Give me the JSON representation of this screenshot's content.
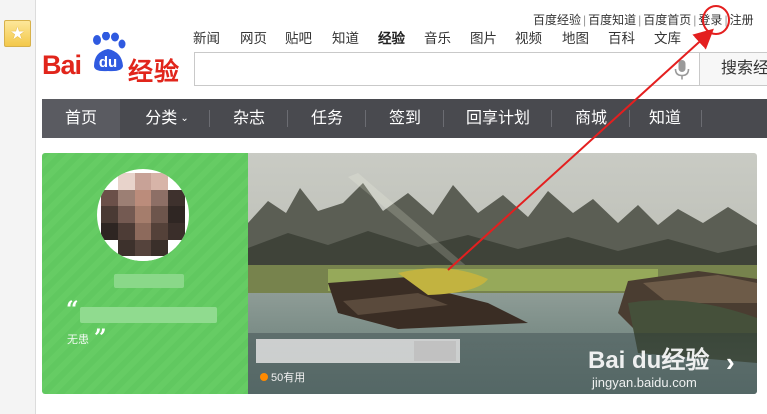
{
  "favorites": {
    "icon": "star-icon",
    "glyph": "★"
  },
  "logo": {
    "bai": "Bai",
    "du": "du",
    "jingyan": "经验",
    "brand_color": "#e1251b",
    "paw_color": "#2f5ae0"
  },
  "top_links": [
    "百度经验",
    "百度知道",
    "百度首页",
    "登录",
    "注册"
  ],
  "product_nav": [
    "新闻",
    "网页",
    "贴吧",
    "知道",
    "经验",
    "音乐",
    "图片",
    "视频",
    "地图",
    "百科",
    "文库"
  ],
  "product_nav_active": "经验",
  "search": {
    "value": "",
    "button_label": "搜索经"
  },
  "main_nav": {
    "items": [
      "首页",
      "分类",
      "杂志",
      "任务",
      "签到",
      "回享计划",
      "商城",
      "知道"
    ],
    "active": "首页",
    "dropdown_caret": "⌄"
  },
  "banner": {
    "quote_open": "“",
    "quote_close": "”",
    "author": "无患",
    "useful_count": "50有用",
    "watermark": "Bai du经验",
    "watermark_url": "jingyan.baidu.com",
    "next_glyph": "›",
    "panel_color": "#64ca63"
  },
  "annotation": {
    "color": "#e41f1f"
  }
}
